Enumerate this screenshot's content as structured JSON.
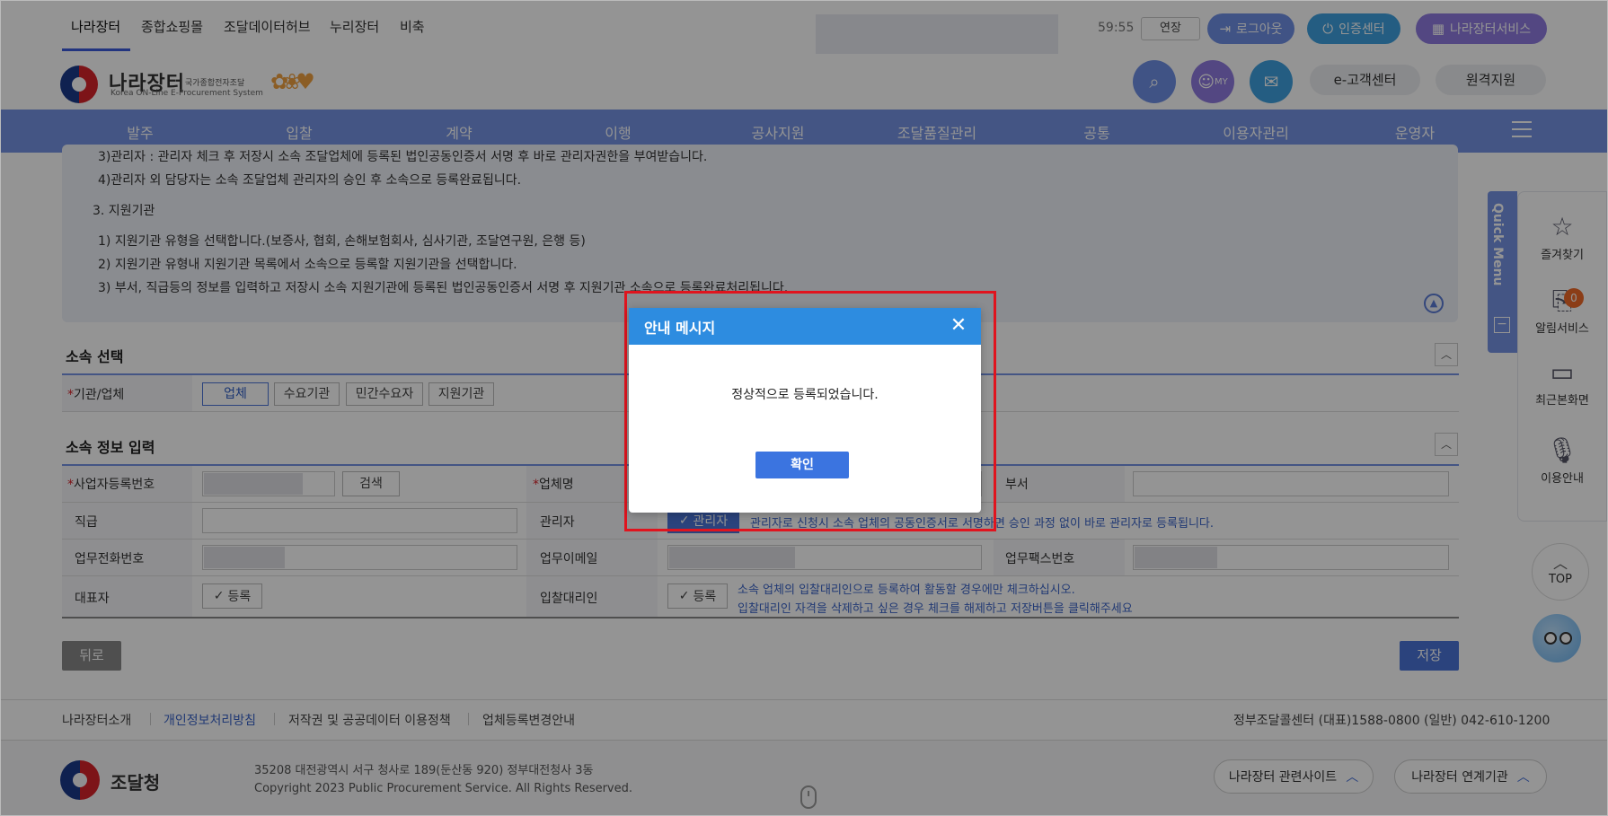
{
  "top_tabs": [
    "나라장터",
    "종합쇼핑몰",
    "조달데이터허브",
    "누리장터",
    "비축"
  ],
  "session": {
    "timer": "59:55",
    "extend_label": "연장"
  },
  "top_pills": {
    "logout": "로그아웃",
    "cert_center": "인증센터",
    "service": "나라장터서비스"
  },
  "logo": {
    "main": "나라장터",
    "sub_kr": "국가종합전자조달",
    "sub_en": "Korea ON-Line E-Procurement System"
  },
  "header_pills": {
    "customer_center": "e-고객센터",
    "remote_support": "원격지원",
    "my_label": "MY"
  },
  "nav": [
    "발주",
    "입찰",
    "계약",
    "이행",
    "공사지원",
    "조달품질관리",
    "공통",
    "이용자관리",
    "운영자"
  ],
  "info_box": {
    "lines": [
      "3)관리자 : 관리자 체크 후 저장시 소속 조달업체에 등록된 법인공동인증서 서명 후 바로 관리자권한을 부여받습니다.",
      "4)관리자 외 담당자는 소속 조달업체 관리자의 승인 후 소속으로 등록완료됩니다.",
      "3. 지원기관",
      "1) 지원기관 유형을 선택합니다.(보증사, 협회, 손해보험회사, 심사기관, 조달연구원, 은행 등)",
      "2) 지원기관 유형내 지원기관 목록에서 소속으로 등록할 지원기관을 선택합니다.",
      "3) 부서, 직급등의 정보를 입력하고 저장시 소속 지원기관에 등록된 법인공동인증서 서명 후 지원기관 소속으로 등록완료처리됩니다."
    ]
  },
  "section_affiliation": {
    "title": "소속 선택",
    "label": "기관/업체",
    "options": [
      "업체",
      "수요기관",
      "민간수요자",
      "지원기관"
    ],
    "selected": "업체"
  },
  "section_info": {
    "title": "소속 정보 입력",
    "labels": {
      "biz_no": "사업자등록번호",
      "company_name": "업체명",
      "dept": "부서",
      "position": "직급",
      "admin": "관리자",
      "phone": "업무전화번호",
      "email": "업무이메일",
      "fax": "업무팩스번호",
      "ceo": "대표자",
      "bid_agent": "입찰대리인"
    },
    "search_btn": "검색",
    "admin_check": "관리자",
    "register_check": "등록",
    "admin_note": "관리자로 신청시 소속 업체의 공동인증서로 서명하면 승인 과정 없이 바로 관리자로 등록됩니다.",
    "bid_note_1": "소속 업체의 입찰대리인으로 등록하여 활동할 경우에만 체크하십시오.",
    "bid_note_2": "입찰대리인 자격을 삭제하고 싶은 경우 체크를 해제하고 저장버튼을 클릭해주세요"
  },
  "buttons": {
    "back": "뒤로",
    "save": "저장"
  },
  "footer": {
    "links": [
      "나라장터소개",
      "개인정보처리방침",
      "저작권 및 공공데이터 이용정책",
      "업체등록변경안내"
    ],
    "callcenter": "정부조달콜센터  (대표)1588-0800  (일반) 042-610-1200",
    "org": "조달청",
    "address": "35208 대전광역시 서구 청사로 189(둔산동 920) 정부대전청사 3동",
    "copyright": "Copyright 2023 Public Procurement Service. All Rights Reserved.",
    "related_sites": "나라장터 관련사이트",
    "linked_orgs": "나라장터 연계기관"
  },
  "quick_menu": {
    "title": "Quick Menu",
    "items": [
      "즐겨찾기",
      "알림서비스",
      "최근본화면",
      "이용안내"
    ],
    "badge": "0",
    "top": "TOP"
  },
  "modal": {
    "title": "안내 메시지",
    "message": "정상적으로 등록되었습니다.",
    "ok": "확인"
  },
  "colors": {
    "nav": "#7593e3",
    "modal_header": "#2d8ce0",
    "primary_button": "#3b74e0",
    "highlight_border": "#e0141e"
  }
}
